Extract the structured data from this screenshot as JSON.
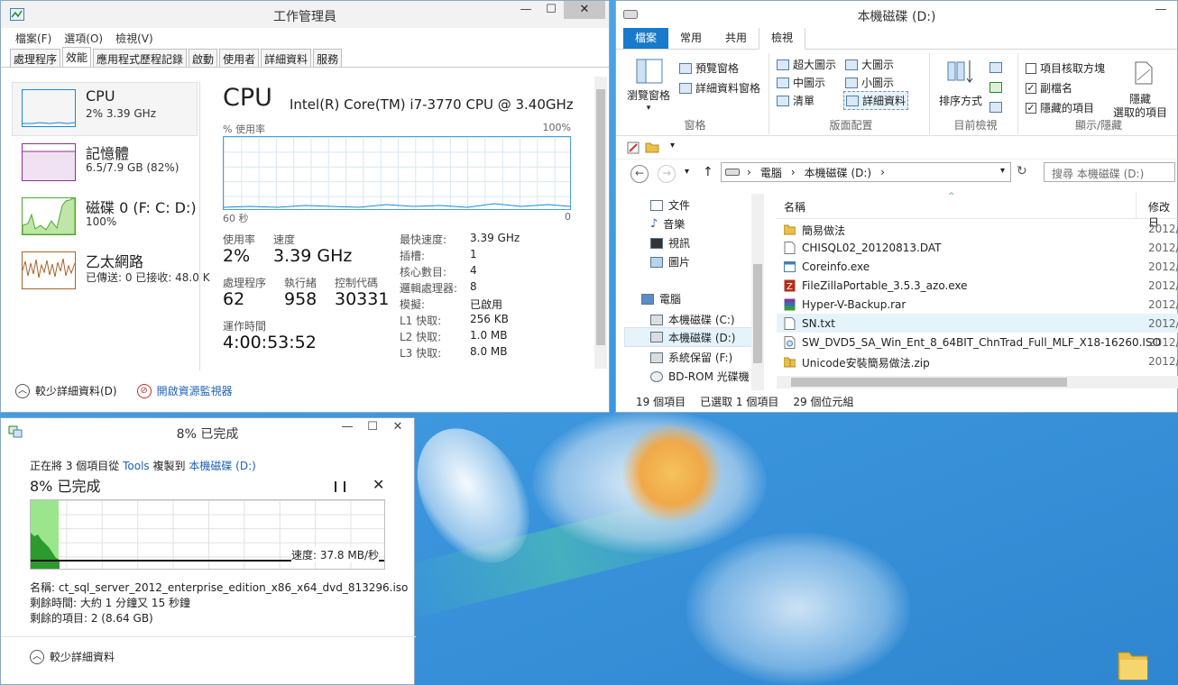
{
  "desktop": {
    "folder_icon": "folder-icon"
  },
  "taskmgr": {
    "title": "工作管理員",
    "menu": [
      "檔案(F)",
      "選項(O)",
      "檢視(V)"
    ],
    "tabs": [
      "處理程序",
      "效能",
      "應用程式歷程記錄",
      "啟動",
      "使用者",
      "詳細資料",
      "服務"
    ],
    "selected_tab": 1,
    "resources": [
      {
        "name": "CPU",
        "sub": "2% 3.39 GHz",
        "color": "#1a8ad4"
      },
      {
        "name": "記憶體",
        "sub": "6.5/7.9 GB (82%)",
        "color": "#8b2f97"
      },
      {
        "name": "磁碟 0 (F: C: D:)",
        "sub": "100%",
        "color": "#4da82e"
      },
      {
        "name": "乙太網路",
        "sub": "已傳送: 0 已接收: 48.0 K",
        "color": "#a7632a"
      }
    ],
    "cpu": {
      "heading": "CPU",
      "model": "Intel(R) Core(TM) i7-3770 CPU @ 3.40GHz",
      "usage_label": "% 使用率",
      "max_label": "100%",
      "time_label": "60 秒",
      "zero_label": "0",
      "stats": [
        {
          "label": "使用率",
          "value": "2%"
        },
        {
          "label": "速度",
          "value": "3.39 GHz"
        },
        {
          "label": "處理程序",
          "value": "62"
        },
        {
          "label": "執行緒",
          "value": "958"
        },
        {
          "label": "控制代碼",
          "value": "30331"
        },
        {
          "label": "運作時間",
          "value": "4:00:53:52"
        }
      ],
      "details": [
        {
          "k": "最快速度:",
          "v": "3.39 GHz"
        },
        {
          "k": "插槽:",
          "v": "1"
        },
        {
          "k": "核心數目:",
          "v": "4"
        },
        {
          "k": "邏輯處理器:",
          "v": "8"
        },
        {
          "k": "模擬:",
          "v": "已啟用"
        },
        {
          "k": "L1 快取:",
          "v": "256 KB"
        },
        {
          "k": "L2 快取:",
          "v": "1.0 MB"
        },
        {
          "k": "L3 快取:",
          "v": "8.0 MB"
        }
      ]
    },
    "footer": {
      "less_details": "較少詳細資料(D)",
      "open_monitor": "開啟資源監視器"
    }
  },
  "explorer": {
    "title": "本機磁碟 (D:)",
    "tabs": [
      "檔案",
      "常用",
      "共用",
      "檢視"
    ],
    "ribbon": {
      "pane_group": {
        "big": "瀏覽窗格",
        "preview": "預覽窗格",
        "details": "詳細資料窗格",
        "label": "窗格"
      },
      "layout_group": {
        "items": [
          "超大圖示",
          "大圖示",
          "中圖示",
          "小圖示",
          "清單",
          "詳細資料"
        ],
        "label": "版面配置"
      },
      "view_group": {
        "sort": "排序方式",
        "label": "目前檢視"
      },
      "show_group": {
        "checks": [
          {
            "label": "項目核取方塊",
            "checked": false
          },
          {
            "label": "副檔名",
            "checked": true
          },
          {
            "label": "隱藏的項目",
            "checked": true
          }
        ],
        "hide_line1": "隱藏",
        "hide_line2": "選取的項目",
        "label": "顯示/隱藏"
      }
    },
    "address": {
      "root": "電腦",
      "current": "本機磁碟 (D:)"
    },
    "search_placeholder": "搜尋 本機磁碟 (D:)",
    "nav": [
      {
        "label": "文件",
        "indent": 1
      },
      {
        "label": "音樂",
        "indent": 1
      },
      {
        "label": "視訊",
        "indent": 1
      },
      {
        "label": "圖片",
        "indent": 1
      },
      {
        "label": "電腦",
        "indent": 0
      },
      {
        "label": "本機磁碟 (C:)",
        "indent": 1
      },
      {
        "label": "本機磁碟 (D:)",
        "indent": 1,
        "selected": true
      },
      {
        "label": "系統保留 (F:)",
        "indent": 1
      },
      {
        "label": "BD-ROM 光碟機",
        "indent": 1
      }
    ],
    "columns": {
      "name": "名稱",
      "date": "修改日"
    },
    "files": [
      {
        "name": "簡易做法",
        "date": "2012/",
        "type": "folder"
      },
      {
        "name": "CHISQL02_20120813.DAT",
        "date": "2012/",
        "type": "file"
      },
      {
        "name": "Coreinfo.exe",
        "date": "2012/",
        "type": "exe"
      },
      {
        "name": "FileZillaPortable_3.5.3_azo.exe",
        "date": "2012/",
        "type": "fz"
      },
      {
        "name": "Hyper-V-Backup.rar",
        "date": "2012/",
        "type": "rar"
      },
      {
        "name": "SN.txt",
        "date": "2012/",
        "type": "file",
        "selected": true
      },
      {
        "name": "SW_DVD5_SA_Win_Ent_8_64BIT_ChnTrad_Full_MLF_X18-16260.ISO",
        "date": "2012/",
        "type": "iso"
      },
      {
        "name": "Unicode安裝簡易做法.zip",
        "date": "2012/",
        "type": "zip"
      }
    ],
    "status": {
      "count": "19 個項目",
      "selected": "已選取 1 個項目",
      "size": "29 個位元組"
    }
  },
  "copy": {
    "title": "8% 已完成",
    "line_prefix": "正在將 3 個項目從",
    "from": "Tools",
    "line_middle": "複製到",
    "to": "本機磁碟 (D:)",
    "heading": "8% 已完成",
    "progress": 0.08,
    "speed": "速度: 37.8 MB/秒",
    "name_line": "名稱: ct_sql_server_2012_enterprise_edition_x86_x64_dvd_813296.iso",
    "time_line": "剩餘時間: 大約 1 分鐘又 15 秒鐘",
    "items_line": "剩餘的項目: 2 (8.64 GB)",
    "less_details": "較少詳細資料"
  }
}
